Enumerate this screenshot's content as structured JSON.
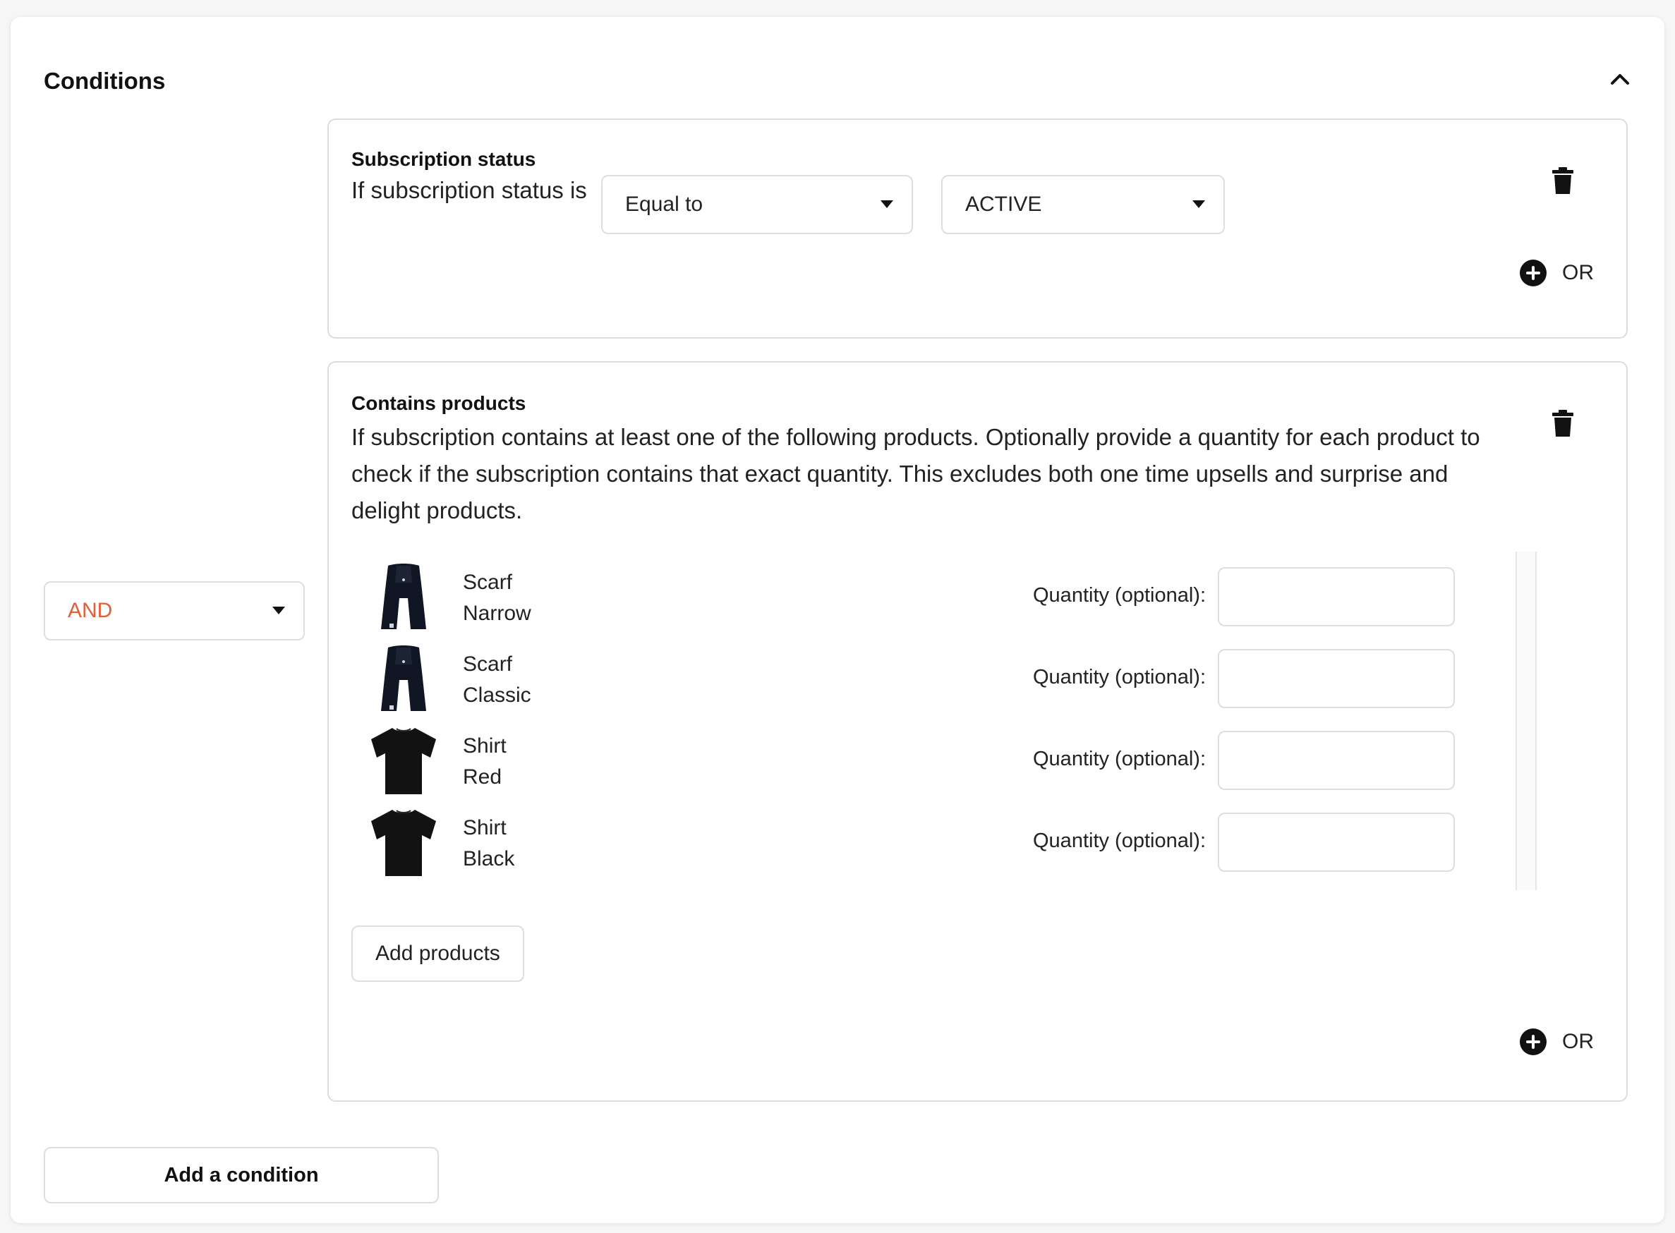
{
  "card": {
    "title": "Conditions"
  },
  "logic_operator": {
    "value": "AND",
    "color": "#e0603a"
  },
  "subscription_status": {
    "title": "Subscription status",
    "prefix": "If subscription status is",
    "operator": "Equal to",
    "value": "ACTIVE",
    "or_label": "OR"
  },
  "contains_products": {
    "title": "Contains products",
    "description": "If subscription contains at least one of the following products. Optionally provide a quantity for each product to check if the subscription contains that exact quantity. This excludes both one time upsells and surprise and delight products.",
    "products": [
      {
        "name": "Scarf",
        "variant": "Narrow",
        "icon": "scarf-icon",
        "qty_label": "Quantity (optional):",
        "qty": ""
      },
      {
        "name": "Scarf",
        "variant": "Classic",
        "icon": "scarf-icon",
        "qty_label": "Quantity (optional):",
        "qty": ""
      },
      {
        "name": "Shirt",
        "variant": "Red",
        "icon": "shirt-icon",
        "qty_label": "Quantity (optional):",
        "qty": ""
      },
      {
        "name": "Shirt",
        "variant": "Black",
        "icon": "shirt-icon",
        "qty_label": "Quantity (optional):",
        "qty": ""
      }
    ],
    "add_products_label": "Add products",
    "or_label": "OR"
  },
  "add_condition_label": "Add a condition"
}
